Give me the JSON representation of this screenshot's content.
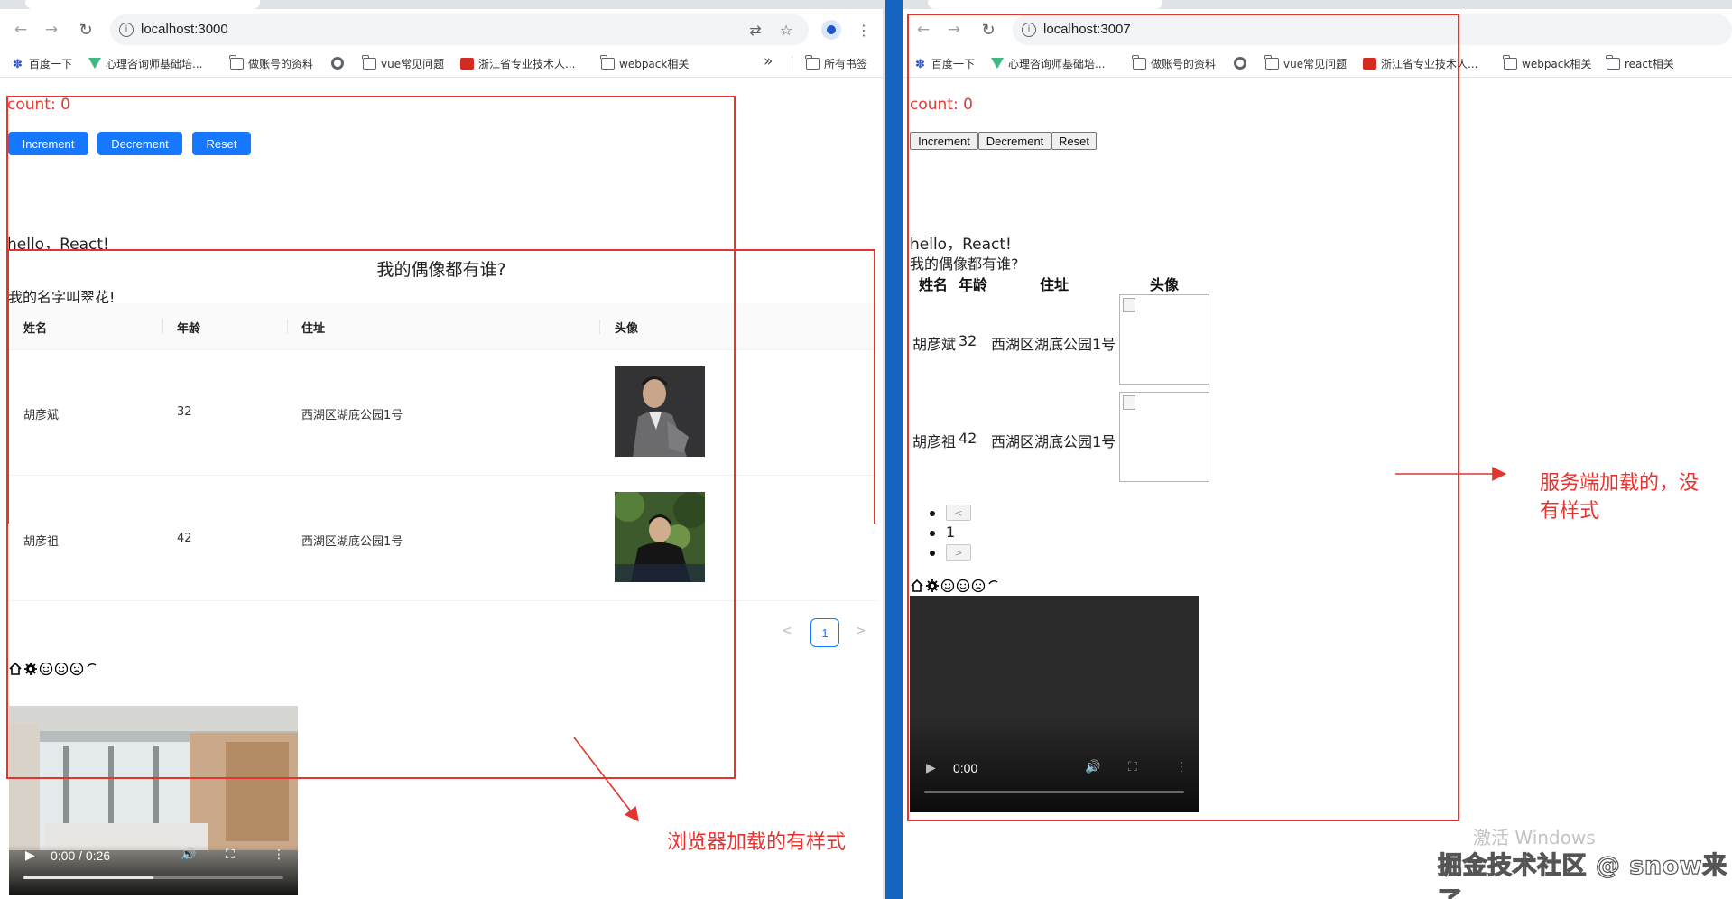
{
  "left": {
    "url": "localhost:3000",
    "bookmarks": [
      "百度一下",
      "心理咨询师基础培...",
      "做账号的资料",
      "",
      "vue常见问题",
      "浙江省专业技术人...",
      "webpack相关"
    ],
    "more_bookmarks": "所有书签",
    "count_text": "count: 0",
    "buttons": {
      "increment": "Increment",
      "decrement": "Decrement",
      "reset": "Reset"
    },
    "hello": "hello，React!",
    "table_title": "我的偶像都有谁?",
    "table_subtitle": "我的名字叫翠花!",
    "columns": [
      "姓名",
      "年龄",
      "住址",
      "头像"
    ],
    "rows": [
      {
        "name": "胡彦斌",
        "age": "32",
        "address": "西湖区湖底公园1号"
      },
      {
        "name": "胡彦祖",
        "age": "42",
        "address": "西湖区湖底公园1号"
      }
    ],
    "pagination": {
      "current": "1",
      "prev": "<",
      "next": ">"
    },
    "video": {
      "time": "0:00 / 0:26",
      "progress": 0.5
    }
  },
  "right": {
    "url": "localhost:3007",
    "bookmarks": [
      "百度一下",
      "心理咨询师基础培...",
      "做账号的资料",
      "",
      "vue常见问题",
      "浙江省专业技术人...",
      "webpack相关",
      "react相关"
    ],
    "count_text": "count: 0",
    "buttons": {
      "increment": "Increment",
      "decrement": "Decrement",
      "reset": "Reset"
    },
    "hello": "hello，React!",
    "table_title": "我的偶像都有谁?",
    "columns": [
      "姓名",
      "年龄",
      "住址",
      "头像"
    ],
    "rows": [
      {
        "name": "胡彦斌",
        "age": "32",
        "address": "西湖区湖底公园1号"
      },
      {
        "name": "胡彦祖",
        "age": "42",
        "address": "西湖区湖底公园1号"
      }
    ],
    "pagination": {
      "current": "1",
      "prev": "<",
      "next": ">"
    },
    "video": {
      "time": "0:00"
    }
  },
  "annotations": {
    "browser_note": "浏览器加载的有样式",
    "server_note_line1": "服务端加载的，没",
    "server_note_line2": "有样式",
    "watermark_windows": "激活 Windows",
    "watermark_site": "掘金技术社区 @ snow来了"
  },
  "colors": {
    "accent": "#1677ff",
    "annotation_red": "#e3342f",
    "count_red": "#e53935"
  }
}
